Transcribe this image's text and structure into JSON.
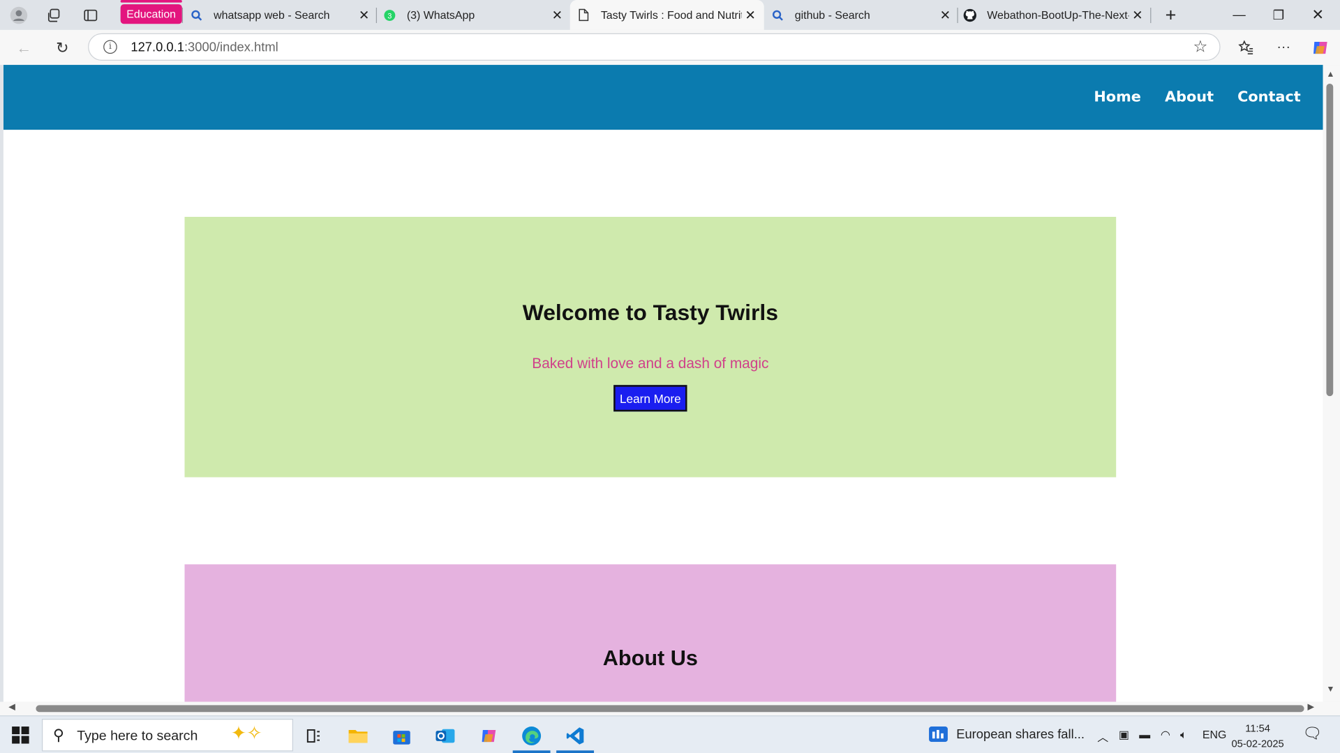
{
  "browser": {
    "tab_group": "Education",
    "tabs": [
      {
        "title": "whatsapp web - Search",
        "icon": "search-icon",
        "active": false
      },
      {
        "title": "(3) WhatsApp",
        "icon": "whatsapp-icon",
        "badge": "3",
        "active": false
      },
      {
        "title": "Tasty Twirls : Food and Nutrition",
        "icon": "page-icon",
        "active": true
      },
      {
        "title": "github - Search",
        "icon": "search-icon",
        "active": false
      },
      {
        "title": "Webathon-BootUp-The-Next-Gen",
        "icon": "github-icon",
        "active": false
      }
    ],
    "url_host": "127.0.0.1",
    "url_rest": ":3000/index.html"
  },
  "site": {
    "nav": [
      "Home",
      "About",
      "Contact"
    ],
    "hero": {
      "title": "Welcome to Tasty Twirls",
      "tagline": "Baked with love and a dash of magic",
      "button": "Learn More"
    },
    "about": {
      "title": "About Us"
    },
    "colors": {
      "nav": "#0b7baf",
      "hero_bg": "#cfeaad",
      "tagline": "#d0408a",
      "button": "#1a1ef0",
      "about_bg": "#e5b2df"
    }
  },
  "taskbar": {
    "search_placeholder": "Type here to search",
    "news": "European shares fall...",
    "lang": "ENG",
    "time": "11:54",
    "date": "05-02-2025"
  }
}
